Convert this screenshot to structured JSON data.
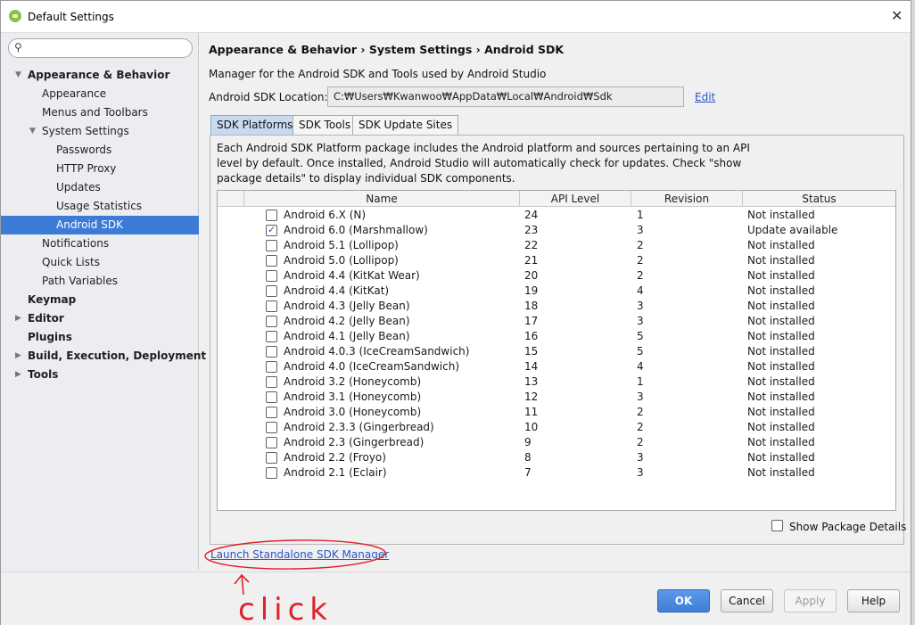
{
  "window": {
    "title": "Default Settings"
  },
  "search": {
    "placeholder": ""
  },
  "tree": [
    {
      "label": "Appearance & Behavior",
      "level": 0,
      "bold": true,
      "expanded": true
    },
    {
      "label": "Appearance",
      "level": 1
    },
    {
      "label": "Menus and Toolbars",
      "level": 1
    },
    {
      "label": "System Settings",
      "level": 1,
      "expanded": true
    },
    {
      "label": "Passwords",
      "level": 2
    },
    {
      "label": "HTTP Proxy",
      "level": 2
    },
    {
      "label": "Updates",
      "level": 2
    },
    {
      "label": "Usage Statistics",
      "level": 2
    },
    {
      "label": "Android SDK",
      "level": 2,
      "selected": true
    },
    {
      "label": "Notifications",
      "level": 1
    },
    {
      "label": "Quick Lists",
      "level": 1
    },
    {
      "label": "Path Variables",
      "level": 1
    },
    {
      "label": "Keymap",
      "level": 0,
      "bold": true
    },
    {
      "label": "Editor",
      "level": 0,
      "bold": true,
      "collapsed": true
    },
    {
      "label": "Plugins",
      "level": 0,
      "bold": true
    },
    {
      "label": "Build, Execution, Deployment",
      "level": 0,
      "bold": true,
      "collapsed": true
    },
    {
      "label": "Tools",
      "level": 0,
      "bold": true,
      "collapsed": true
    }
  ],
  "main": {
    "breadcrumb": "Appearance & Behavior › System Settings › Android SDK",
    "description": "Manager for the Android SDK and Tools used by Android Studio",
    "sdk_location_label": "Android SDK Location:",
    "sdk_location_value": "C:₩Users₩Kwanwoo₩AppData₩Local₩Android₩Sdk",
    "edit_label": "Edit",
    "tabs": [
      {
        "label": "SDK Platforms",
        "active": true
      },
      {
        "label": "SDK Tools"
      },
      {
        "label": "SDK Update Sites"
      }
    ],
    "panel_description": "Each Android SDK Platform package includes the Android platform and sources pertaining to an API level by default. Once installed, Android Studio will automatically check for updates. Check \"show package details\" to display individual SDK components.",
    "columns": [
      "Name",
      "API Level",
      "Revision",
      "Status"
    ],
    "rows": [
      {
        "name": "Android 6.X (N)",
        "api": "24",
        "rev": "1",
        "status": "Not installed",
        "checked": false
      },
      {
        "name": "Android 6.0 (Marshmallow)",
        "api": "23",
        "rev": "3",
        "status": "Update available",
        "checked": true
      },
      {
        "name": "Android 5.1 (Lollipop)",
        "api": "22",
        "rev": "2",
        "status": "Not installed",
        "checked": false
      },
      {
        "name": "Android 5.0 (Lollipop)",
        "api": "21",
        "rev": "2",
        "status": "Not installed",
        "checked": false
      },
      {
        "name": "Android 4.4 (KitKat Wear)",
        "api": "20",
        "rev": "2",
        "status": "Not installed",
        "checked": false
      },
      {
        "name": "Android 4.4 (KitKat)",
        "api": "19",
        "rev": "4",
        "status": "Not installed",
        "checked": false
      },
      {
        "name": "Android 4.3 (Jelly Bean)",
        "api": "18",
        "rev": "3",
        "status": "Not installed",
        "checked": false
      },
      {
        "name": "Android 4.2 (Jelly Bean)",
        "api": "17",
        "rev": "3",
        "status": "Not installed",
        "checked": false
      },
      {
        "name": "Android 4.1 (Jelly Bean)",
        "api": "16",
        "rev": "5",
        "status": "Not installed",
        "checked": false
      },
      {
        "name": "Android 4.0.3 (IceCreamSandwich)",
        "api": "15",
        "rev": "5",
        "status": "Not installed",
        "checked": false
      },
      {
        "name": "Android 4.0 (IceCreamSandwich)",
        "api": "14",
        "rev": "4",
        "status": "Not installed",
        "checked": false
      },
      {
        "name": "Android 3.2 (Honeycomb)",
        "api": "13",
        "rev": "1",
        "status": "Not installed",
        "checked": false
      },
      {
        "name": "Android 3.1 (Honeycomb)",
        "api": "12",
        "rev": "3",
        "status": "Not installed",
        "checked": false
      },
      {
        "name": "Android 3.0 (Honeycomb)",
        "api": "11",
        "rev": "2",
        "status": "Not installed",
        "checked": false
      },
      {
        "name": "Android 2.3.3 (Gingerbread)",
        "api": "10",
        "rev": "2",
        "status": "Not installed",
        "checked": false
      },
      {
        "name": "Android 2.3 (Gingerbread)",
        "api": "9",
        "rev": "2",
        "status": "Not installed",
        "checked": false
      },
      {
        "name": "Android 2.2 (Froyo)",
        "api": "8",
        "rev": "3",
        "status": "Not installed",
        "checked": false
      },
      {
        "name": "Android 2.1 (Eclair)",
        "api": "7",
        "rev": "3",
        "status": "Not installed",
        "checked": false
      }
    ],
    "show_package_details_label": "Show Package Details",
    "launch_link": "Launch Standalone SDK Manager"
  },
  "buttons": {
    "ok": "OK",
    "cancel": "Cancel",
    "apply": "Apply",
    "help": "Help"
  },
  "annotation": {
    "text": "click",
    "color": "#e0202a"
  },
  "colors": {
    "selection": "#3c7bd6",
    "link": "#2a56c6",
    "primary_button": "#3e7fd6"
  }
}
